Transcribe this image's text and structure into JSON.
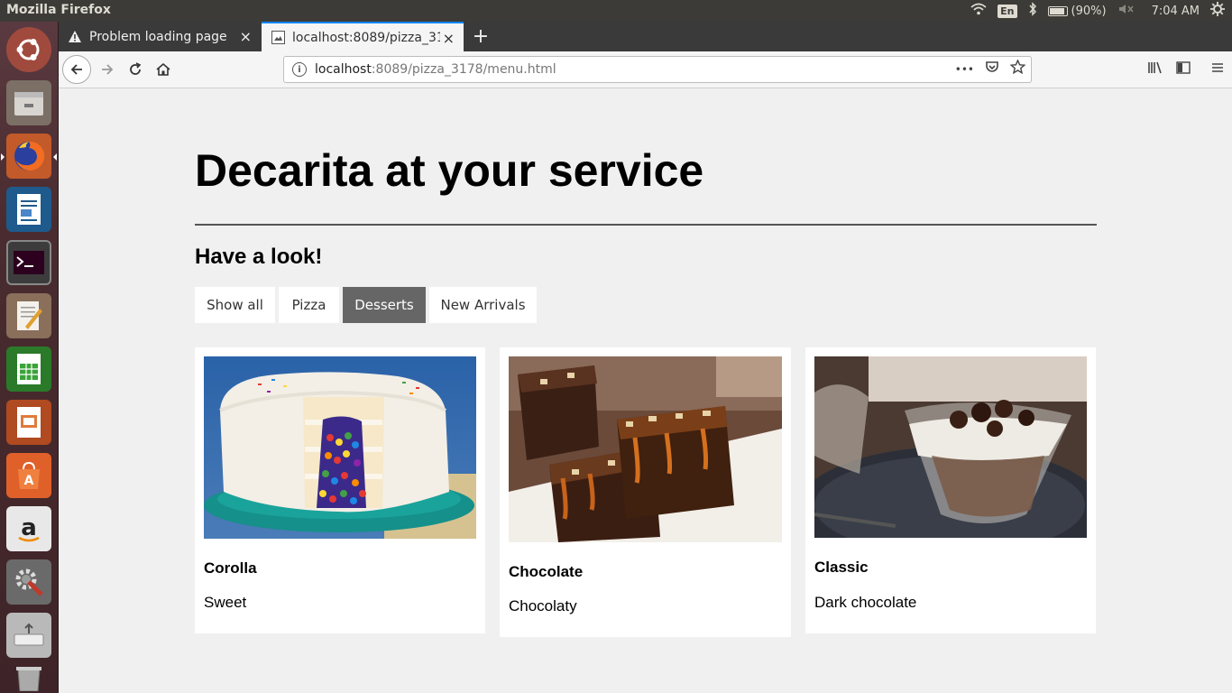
{
  "system": {
    "app_title": "Mozilla Firefox",
    "keyboard_layout": "En",
    "battery": "(90%)",
    "time": "7:04 AM"
  },
  "launcher": {
    "items": [
      "ubuntu-dash-icon",
      "files-icon",
      "firefox-icon",
      "writer-icon",
      "terminal-icon",
      "text-editor-icon",
      "calc-icon",
      "impress-icon",
      "software-center-icon",
      "amazon-icon",
      "settings-icon",
      "usb-creator-icon",
      "trash-icon"
    ]
  },
  "tabs": [
    {
      "label": "Problem loading page",
      "icon": "warning-icon",
      "close": "×"
    },
    {
      "label": "localhost:8089/pizza_31",
      "icon": "page-icon",
      "close": "×"
    }
  ],
  "newtab_label": "+",
  "navbar": {
    "url_host": "localhost",
    "url_path": ":8089/pizza_3178/menu.html",
    "more_label": "•••"
  },
  "page": {
    "title": "Decarita at your service",
    "subtitle": "Have a look!",
    "filters": [
      {
        "label": "Show all",
        "active": false
      },
      {
        "label": "Pizza",
        "active": false
      },
      {
        "label": "Desserts",
        "active": true
      },
      {
        "label": "New Arrivals",
        "active": false
      }
    ],
    "cards": [
      {
        "title": "Corolla",
        "description": "Sweet",
        "image": "rainbow-cake-image"
      },
      {
        "title": "Chocolate",
        "description": "Chocolaty",
        "image": "caramel-brownie-image"
      },
      {
        "title": "Classic",
        "description": "Dark chocolate",
        "image": "chocolate-mousse-image"
      }
    ]
  },
  "colors": {
    "accent_tab": "#0a84ff",
    "active_filter": "#666666",
    "page_bg": "#f0f0f0"
  }
}
